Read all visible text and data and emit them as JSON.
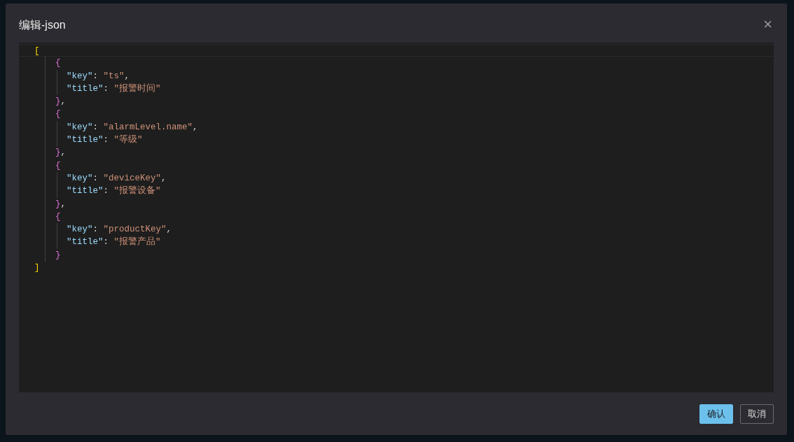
{
  "dialog": {
    "title": "编辑-json",
    "close": "×"
  },
  "editor": {
    "open": "[",
    "close": "]",
    "children": [
      {
        "open": "{",
        "close": "},",
        "lines": [
          [
            {
              "kind": "key",
              "text": "\"key\""
            },
            {
              "kind": "punct",
              "text": ": "
            },
            {
              "kind": "string",
              "text": "\"ts\""
            },
            {
              "kind": "punct",
              "text": ","
            }
          ],
          [
            {
              "kind": "key",
              "text": "\"title\""
            },
            {
              "kind": "punct",
              "text": ": "
            },
            {
              "kind": "string",
              "text": "\"报警时间\""
            }
          ]
        ]
      },
      {
        "open": "{",
        "close": "},",
        "lines": [
          [
            {
              "kind": "key",
              "text": "\"key\""
            },
            {
              "kind": "punct",
              "text": ": "
            },
            {
              "kind": "string",
              "text": "\"alarmLevel.name\""
            },
            {
              "kind": "punct",
              "text": ","
            }
          ],
          [
            {
              "kind": "key",
              "text": "\"title\""
            },
            {
              "kind": "punct",
              "text": ": "
            },
            {
              "kind": "string",
              "text": "\"等级\""
            }
          ]
        ]
      },
      {
        "open": "{",
        "close": "},",
        "lines": [
          [
            {
              "kind": "key",
              "text": "\"key\""
            },
            {
              "kind": "punct",
              "text": ": "
            },
            {
              "kind": "string",
              "text": "\"deviceKey\""
            },
            {
              "kind": "punct",
              "text": ","
            }
          ],
          [
            {
              "kind": "key",
              "text": "\"title\""
            },
            {
              "kind": "punct",
              "text": ": "
            },
            {
              "kind": "string",
              "text": "\"报警设备\""
            }
          ]
        ]
      },
      {
        "open": "{",
        "close": "}",
        "lines": [
          [
            {
              "kind": "key",
              "text": "\"key\""
            },
            {
              "kind": "punct",
              "text": ": "
            },
            {
              "kind": "string",
              "text": "\"productKey\""
            },
            {
              "kind": "punct",
              "text": ","
            }
          ],
          [
            {
              "kind": "key",
              "text": "\"title\""
            },
            {
              "kind": "punct",
              "text": ": "
            },
            {
              "kind": "string",
              "text": "\"报警产品\""
            }
          ]
        ]
      }
    ]
  },
  "buttons": [
    {
      "label": "确认",
      "kind": "primary"
    },
    {
      "label": "取消",
      "kind": "secondary"
    }
  ]
}
